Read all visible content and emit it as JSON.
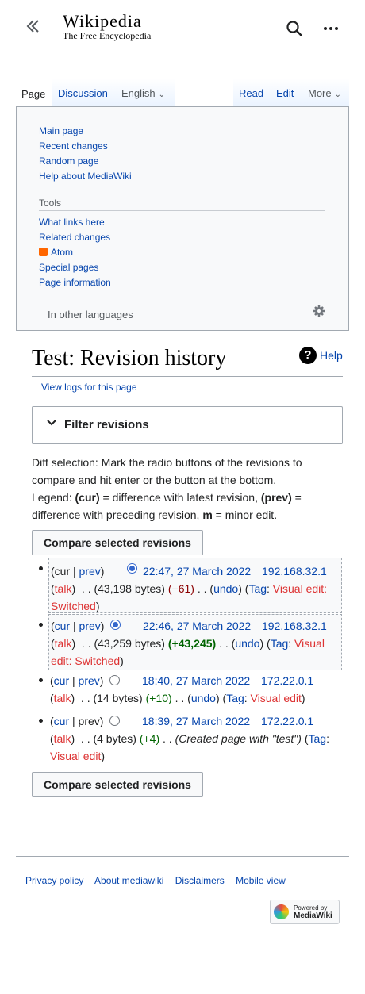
{
  "header": {
    "logo_word": "Wikipedia",
    "logo_tagline": "The Free Encyclopedia"
  },
  "tabs": {
    "page": "Page",
    "discussion": "Discussion",
    "language": "English",
    "read": "Read",
    "edit": "Edit",
    "more": "More"
  },
  "menu": {
    "nav_items": [
      "Main page",
      "Recent changes",
      "Random page",
      "Help about MediaWiki"
    ],
    "tools_heading": "Tools",
    "tools_items": [
      "What links here",
      "Related changes",
      "Atom",
      "Special pages",
      "Page information"
    ],
    "languages_heading": "In other languages"
  },
  "page": {
    "title": "Test: Revision history",
    "help": "Help",
    "view_logs": "View logs for this page"
  },
  "filter": {
    "label": "Filter revisions"
  },
  "diff_help": {
    "line1": "Diff selection: Mark the radio buttons of the revisions to compare and hit enter or the button at the bottom.",
    "legend_prefix": "Legend: ",
    "cur_term": "(cur)",
    "cur_desc": " = difference with latest revision, ",
    "prev_term": "(prev)",
    "prev_desc": " = difference with preceding revision, ",
    "m_term": "m",
    "m_desc": " = minor edit."
  },
  "compare_button": "Compare selected revisions",
  "revisions": [
    {
      "cur": "cur",
      "prev": "prev",
      "timestamp": "22:47, 27 March 2022",
      "user": "192.168.32.1",
      "talk": "talk",
      "size": "(43,198 bytes)",
      "diff": "(−61)",
      "undo": "undo",
      "tag_label": "Tag",
      "tag": "Visual edit: Switched",
      "summary": ""
    },
    {
      "cur": "cur",
      "prev": "prev",
      "timestamp": "22:46, 27 March 2022",
      "user": "192.168.32.1",
      "talk": "talk",
      "size": "(43,259 bytes)",
      "diff": "(+43,245)",
      "undo": "undo",
      "tag_label": "Tag",
      "tag": "Visual edit: Switched",
      "summary": ""
    },
    {
      "cur": "cur",
      "prev": "prev",
      "timestamp": "18:40, 27 March 2022",
      "user": "172.22.0.1",
      "talk": "talk",
      "size": "(14 bytes)",
      "diff": "(+10)",
      "undo": "undo",
      "tag_label": "Tag",
      "tag": "Visual edit",
      "summary": ""
    },
    {
      "cur": "cur",
      "prev": "prev",
      "timestamp": "18:39, 27 March 2022",
      "user": "172.22.0.1",
      "talk": "talk",
      "size": "(4 bytes)",
      "diff": "(+4)",
      "undo": "",
      "tag_label": "Tag",
      "tag": "Visual edit",
      "summary": "(Created page with \"test\")"
    }
  ],
  "footer": {
    "links": [
      "Privacy policy",
      "About mediawiki",
      "Disclaimers",
      "Mobile view"
    ],
    "powered_line1": "Powered by",
    "powered_line2": "MediaWiki"
  }
}
